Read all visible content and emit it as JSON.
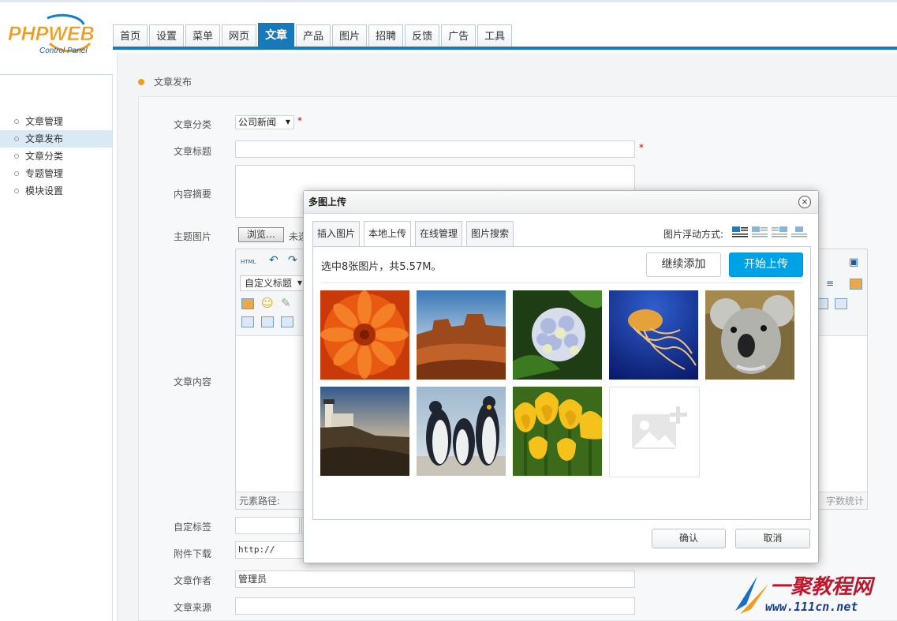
{
  "logo": {
    "text": "PHPWEB",
    "subtitle": "Control Panel"
  },
  "nav": {
    "tabs": [
      "首页",
      "设置",
      "菜单",
      "网页",
      "文章",
      "产品",
      "图片",
      "招聘",
      "反馈",
      "广告",
      "工具"
    ],
    "active": "文章"
  },
  "sidebar": {
    "items": [
      "文章管理",
      "文章发布",
      "文章分类",
      "专题管理",
      "模块设置"
    ],
    "active": "文章发布"
  },
  "breadcrumb": "文章发布",
  "form": {
    "category_label": "文章分类",
    "category_value": "公司新闻",
    "title_label": "文章标题",
    "summary_label": "内容摘要",
    "image_label": "主题图片",
    "browse_label": "浏览…",
    "file_status": "未选",
    "content_label": "文章内容",
    "editor_html_label": "HTML",
    "editor_heading_select": "自定义标题",
    "editor_path_label": "元素路径:",
    "editor_wordcount": "字数统计",
    "tags_label": "自定标签",
    "attachment_label": "附件下载",
    "attachment_value": "http://",
    "author_label": "文章作者",
    "author_value": "管理员",
    "source_label": "文章来源",
    "required_mark": "*"
  },
  "dialog": {
    "title": "多图上传",
    "close": "×",
    "tabs": [
      "插入图片",
      "本地上传",
      "在线管理",
      "图片搜索"
    ],
    "active_tab": "本地上传",
    "float_label": "图片浮动方式:",
    "selection_info": "选中8张图片，共5.57M。",
    "add_more": "继续添加",
    "start_upload": "开始上传",
    "images": [
      "chrysanthemum-icon",
      "desert-icon",
      "hydrangea-icon",
      "jellyfish-icon",
      "koala-icon",
      "lighthouse-icon",
      "penguins-icon",
      "tulips-icon"
    ],
    "confirm": "确认",
    "cancel": "取消"
  },
  "watermark": {
    "brand": "一聚教程网",
    "url": "www.111cn.net"
  },
  "colors": {
    "accent": "#1878b8",
    "upload": "#00a2e6",
    "bullet": "#f29c1f"
  }
}
